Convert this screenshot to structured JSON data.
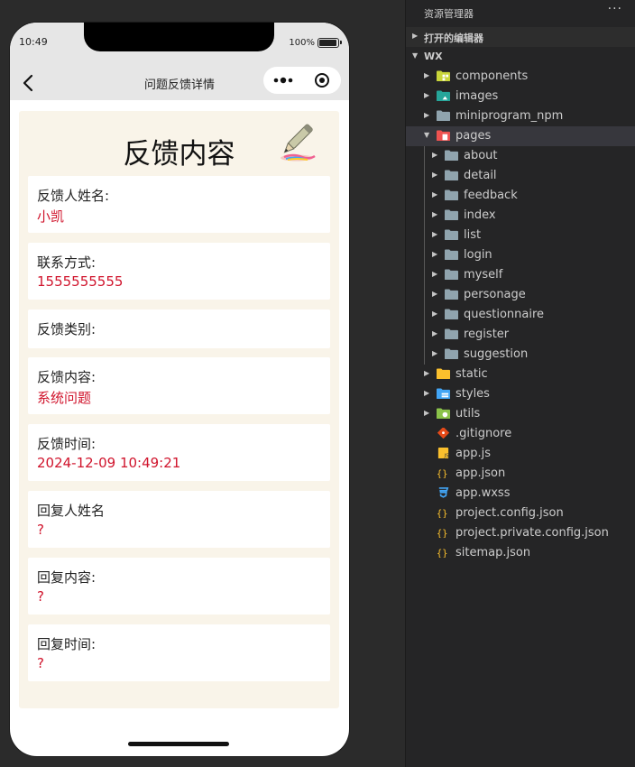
{
  "phone": {
    "status": {
      "time": "10:49",
      "battery": "100%"
    },
    "nav": {
      "title": "问题反馈详情"
    },
    "header": {
      "title": "反馈内容"
    },
    "fields": [
      {
        "label": "反馈人姓名:",
        "value": "小凯"
      },
      {
        "label": "联系方式:",
        "value": "1555555555"
      },
      {
        "label": "反馈类别:",
        "value": ""
      },
      {
        "label": "反馈内容:",
        "value": "系统问题"
      },
      {
        "label": "反馈时间:",
        "value": "2024-12-09 10:49:21"
      },
      {
        "label": "回复人姓名",
        "value": "?"
      },
      {
        "label": "回复内容:",
        "value": "?"
      },
      {
        "label": "回复时间:",
        "value": "?"
      }
    ],
    "colors": {
      "value_text": "#d0142c",
      "content_bg": "#f9f4e9"
    }
  },
  "explorer": {
    "title": "资源管理器",
    "more": "···",
    "sections": {
      "open_editors": "打开的编辑器",
      "root": "WX"
    },
    "tree": [
      {
        "name": "components",
        "type": "folder",
        "icon": "components-folder-icon",
        "color": "#c9d53a",
        "expanded": false
      },
      {
        "name": "images",
        "type": "folder",
        "icon": "images-folder-icon",
        "color": "#26a69a",
        "expanded": false
      },
      {
        "name": "miniprogram_npm",
        "type": "folder",
        "icon": "folder-icon",
        "color": "#90a4ae",
        "expanded": false
      },
      {
        "name": "pages",
        "type": "folder",
        "icon": "pages-folder-icon",
        "color": "#ef5350",
        "expanded": true,
        "selected": true
      },
      {
        "name": "about",
        "type": "folder",
        "icon": "folder-icon",
        "color": "#90a4ae",
        "expanded": false,
        "depth": 1
      },
      {
        "name": "detail",
        "type": "folder",
        "icon": "folder-icon",
        "color": "#90a4ae",
        "expanded": false,
        "depth": 1
      },
      {
        "name": "feedback",
        "type": "folder",
        "icon": "folder-icon",
        "color": "#90a4ae",
        "expanded": false,
        "depth": 1
      },
      {
        "name": "index",
        "type": "folder",
        "icon": "folder-icon",
        "color": "#90a4ae",
        "expanded": false,
        "depth": 1
      },
      {
        "name": "list",
        "type": "folder",
        "icon": "folder-icon",
        "color": "#90a4ae",
        "expanded": false,
        "depth": 1
      },
      {
        "name": "login",
        "type": "folder",
        "icon": "folder-icon",
        "color": "#90a4ae",
        "expanded": false,
        "depth": 1
      },
      {
        "name": "myself",
        "type": "folder",
        "icon": "folder-icon",
        "color": "#90a4ae",
        "expanded": false,
        "depth": 1
      },
      {
        "name": "personage",
        "type": "folder",
        "icon": "folder-icon",
        "color": "#90a4ae",
        "expanded": false,
        "depth": 1
      },
      {
        "name": "questionnaire",
        "type": "folder",
        "icon": "folder-icon",
        "color": "#90a4ae",
        "expanded": false,
        "depth": 1
      },
      {
        "name": "register",
        "type": "folder",
        "icon": "folder-icon",
        "color": "#90a4ae",
        "expanded": false,
        "depth": 1
      },
      {
        "name": "suggestion",
        "type": "folder",
        "icon": "folder-icon",
        "color": "#90a4ae",
        "expanded": false,
        "depth": 1
      },
      {
        "name": "static",
        "type": "folder",
        "icon": "static-folder-icon",
        "color": "#fbc02d",
        "expanded": false
      },
      {
        "name": "styles",
        "type": "folder",
        "icon": "styles-folder-icon",
        "color": "#42a5f5",
        "expanded": false
      },
      {
        "name": "utils",
        "type": "folder",
        "icon": "utils-folder-icon",
        "color": "#8bc34a",
        "expanded": false
      },
      {
        "name": ".gitignore",
        "type": "file",
        "icon": "git-icon",
        "color": "#e64a19"
      },
      {
        "name": "app.js",
        "type": "file",
        "icon": "js-file-icon",
        "color": "#fbc02d"
      },
      {
        "name": "app.json",
        "type": "file",
        "icon": "json-file-icon",
        "color": "#fbc02d"
      },
      {
        "name": "app.wxss",
        "type": "file",
        "icon": "css-file-icon",
        "color": "#42a5f5"
      },
      {
        "name": "project.config.json",
        "type": "file",
        "icon": "json-file-icon",
        "color": "#fbc02d"
      },
      {
        "name": "project.private.config.json",
        "type": "file",
        "icon": "json-file-icon",
        "color": "#fbc02d"
      },
      {
        "name": "sitemap.json",
        "type": "file",
        "icon": "json-file-icon",
        "color": "#fbc02d"
      }
    ]
  }
}
